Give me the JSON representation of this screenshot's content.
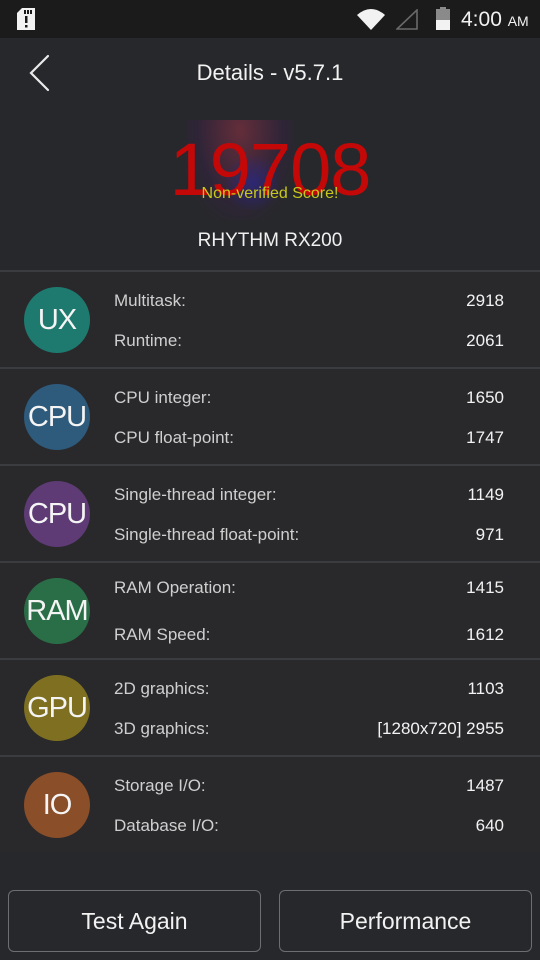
{
  "status_bar": {
    "time": "4:00",
    "ampm": "AM",
    "icons": [
      "sd-card-alert-icon",
      "wifi-icon",
      "cellular-signal-empty-icon",
      "battery-icon"
    ]
  },
  "header": {
    "back_icon": "chevron-left-icon",
    "title": "Details - v5.7.1"
  },
  "score": {
    "total": "19708",
    "note": "Non-verified Score!",
    "device": "RHYTHM RX200",
    "score_color": "#c40808",
    "note_color": "#c8c81a"
  },
  "categories": [
    {
      "badge": "UX",
      "color": "#1e7a6f",
      "items": [
        {
          "label": "Multitask:",
          "value": "2918"
        },
        {
          "label": "Runtime:",
          "value": "2061"
        }
      ]
    },
    {
      "badge": "CPU",
      "color": "#2e5a7c",
      "items": [
        {
          "label": "CPU integer:",
          "value": "1650"
        },
        {
          "label": "CPU float-point:",
          "value": "1747"
        }
      ]
    },
    {
      "badge": "CPU",
      "color": "#5e3b75",
      "items": [
        {
          "label": "Single-thread integer:",
          "value": "1149"
        },
        {
          "label": "Single-thread float-point:",
          "value": "971"
        }
      ]
    },
    {
      "badge": "RAM",
      "color": "#2a6e47",
      "items": [
        {
          "label": "RAM Operation:",
          "value": "1415"
        },
        {
          "label": "RAM Speed:",
          "value": "1612"
        }
      ]
    },
    {
      "badge": "GPU",
      "color": "#7e7020",
      "items": [
        {
          "label": "2D graphics:",
          "value": "1103"
        },
        {
          "label": "3D graphics:",
          "value": "[1280x720] 2955"
        }
      ]
    },
    {
      "badge": "IO",
      "color": "#8a4e28",
      "items": [
        {
          "label": "Storage I/O:",
          "value": "1487"
        },
        {
          "label": "Database I/O:",
          "value": "640"
        }
      ]
    }
  ],
  "buttons": {
    "test_again": "Test Again",
    "performance": "Performance"
  }
}
